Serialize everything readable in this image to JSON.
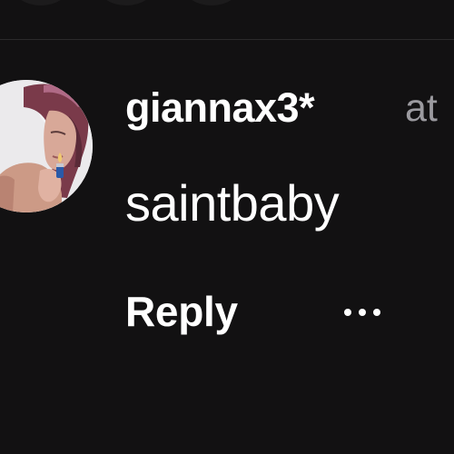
{
  "comment": {
    "username": "giannax3*",
    "mention_prefix": "at",
    "text": "saintbaby",
    "reply_label": "Reply",
    "more_icon": "more-horizontal-icon"
  },
  "colors": {
    "background": "#121112",
    "primary_text": "#ffffff",
    "secondary_text": "#9b9a9f",
    "divider": "#2b2a2b"
  }
}
